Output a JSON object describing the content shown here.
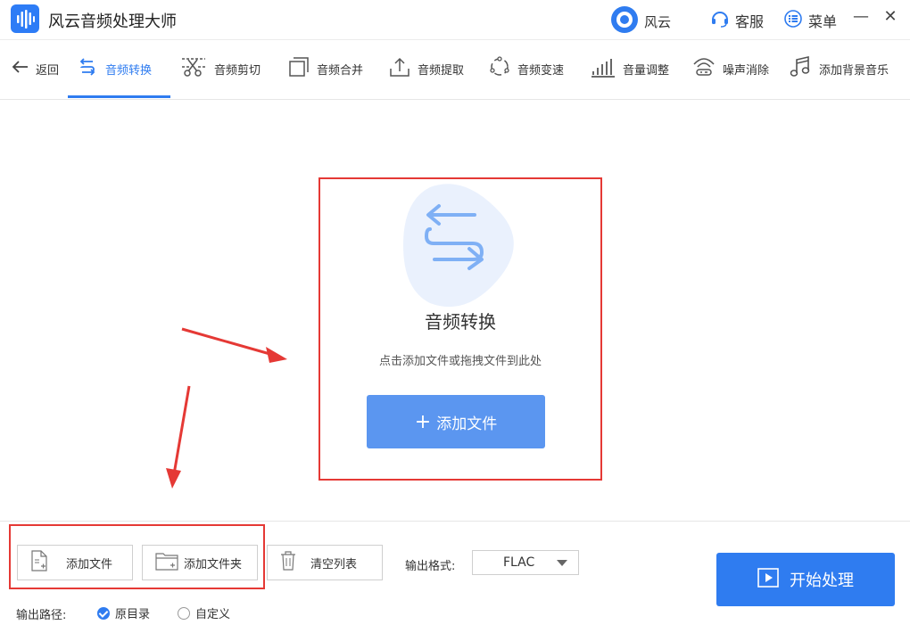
{
  "app": {
    "title": "风云音频处理大师"
  },
  "titlebar": {
    "brand_label": "风云",
    "service_label": "客服",
    "menu_label": "菜单",
    "minimize": "—",
    "close": "✕"
  },
  "toolbar": {
    "back_label": "返回",
    "tools": [
      {
        "label": "音频转换",
        "icon": "convert-icon"
      },
      {
        "label": "音频剪切",
        "icon": "scissors-icon"
      },
      {
        "label": "音频合并",
        "icon": "merge-icon"
      },
      {
        "label": "音频提取",
        "icon": "extract-icon"
      },
      {
        "label": "音频变速",
        "icon": "speed-icon"
      },
      {
        "label": "音量调整",
        "icon": "volume-icon"
      },
      {
        "label": "噪声消除",
        "icon": "noise-icon"
      },
      {
        "label": "添加背景音乐",
        "icon": "music-icon"
      }
    ],
    "active_index": 0
  },
  "drop": {
    "title": "音频转换",
    "hint": "点击添加文件或拖拽文件到此处",
    "add_button": "添加文件"
  },
  "bottom": {
    "add_file": "添加文件",
    "add_folder": "添加文件夹",
    "clear_list": "清空列表",
    "format_label": "输出格式:",
    "format_value": "FLAC",
    "path_label": "输出路径:",
    "path_options": [
      {
        "label": "原目录",
        "selected": true
      },
      {
        "label": "自定义",
        "selected": false
      }
    ],
    "start_button": "开始处理"
  },
  "colors": {
    "accent": "#2f7cf0",
    "add_button": "#5b96f0",
    "highlight_box": "#e53935"
  }
}
